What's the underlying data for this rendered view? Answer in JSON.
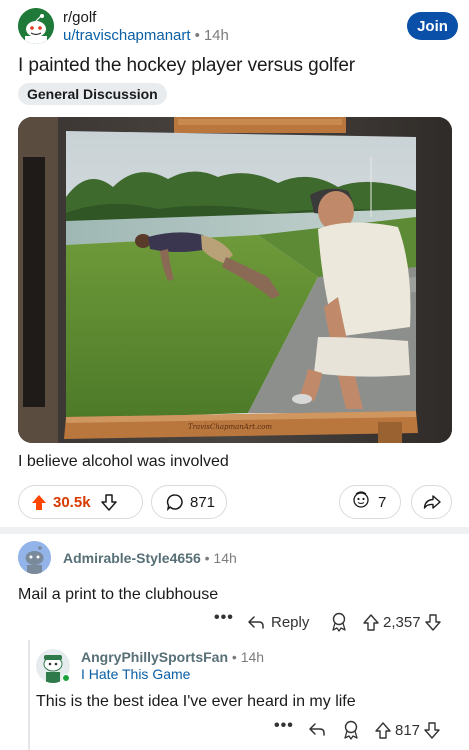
{
  "post": {
    "subreddit": "r/golf",
    "author": "u/travischapmanart",
    "time": "14h",
    "join_label": "Join",
    "title": "I painted the hockey player versus golfer",
    "flair": "General Discussion",
    "body": "I believe alcohol was involved",
    "painting_signature": "TravisChapmanArt.com",
    "votes": "30.5k",
    "comments": "871",
    "awards": "7"
  },
  "comments": [
    {
      "user": "Admirable-Style4656",
      "time": "14h",
      "body": "Mail a print to the clubhouse",
      "reply_label": "Reply",
      "votes": "2,357"
    },
    {
      "user": "AngryPhillySportsFan",
      "time": "14h",
      "flair": "I Hate This Game",
      "body": "This is the best idea I've ever heard in my life",
      "votes": "817"
    }
  ],
  "colors": {
    "upvote_active": "#ff4500",
    "vote_count": "#d93a00",
    "join_bg": "#0a4fa8",
    "link": "#0b5fa5"
  }
}
